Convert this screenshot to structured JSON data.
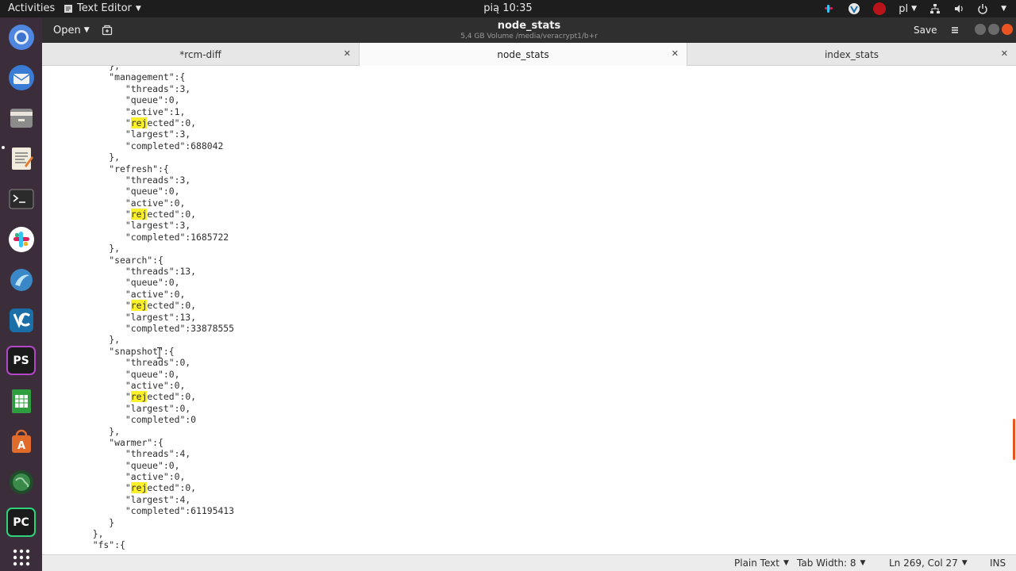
{
  "topbar": {
    "activities": "Activities",
    "app_name": "Text Editor",
    "clock": "pią 10:35",
    "keyboard_layout": "pl"
  },
  "window": {
    "title": "node_stats",
    "subtitle": "5,4 GB Volume /media/veracrypt1/b+r",
    "open_label": "Open",
    "save_label": "Save"
  },
  "tabs": [
    {
      "label": "*rcm-diff",
      "active": false
    },
    {
      "label": "node_stats",
      "active": true
    },
    {
      "label": "index_stats",
      "active": false
    }
  ],
  "search_highlight": "rej",
  "code_lines": [
    "            },",
    "            \"management\":{",
    "               \"threads\":3,",
    "               \"queue\":0,",
    "               \"active\":1,",
    "               \"rejected\":0,",
    "               \"largest\":3,",
    "               \"completed\":688042",
    "            },",
    "            \"refresh\":{",
    "               \"threads\":3,",
    "               \"queue\":0,",
    "               \"active\":0,",
    "               \"rejected\":0,",
    "               \"largest\":3,",
    "               \"completed\":1685722",
    "            },",
    "            \"search\":{",
    "               \"threads\":13,",
    "               \"queue\":0,",
    "               \"active\":0,",
    "               \"rejected\":0,",
    "               \"largest\":13,",
    "               \"completed\":33878555",
    "            },",
    "            \"snapshot\":{",
    "               \"threads\":0,",
    "               \"queue\":0,",
    "               \"active\":0,",
    "               \"rejected\":0,",
    "               \"largest\":0,",
    "               \"completed\":0",
    "            },",
    "            \"warmer\":{",
    "               \"threads\":4,",
    "               \"queue\":0,",
    "               \"active\":0,",
    "               \"rejected\":0,",
    "               \"largest\":4,",
    "               \"completed\":61195413",
    "            }",
    "         },",
    "         \"fs\":{"
  ],
  "statusbar": {
    "language": "Plain Text",
    "tab_width": "Tab Width: 8",
    "position": "Ln 269, Col 27",
    "mode": "INS"
  },
  "dock": [
    {
      "name": "chromium-icon",
      "color": "#3f7fd6"
    },
    {
      "name": "thunderbird-icon",
      "color": "#2f6fb8"
    },
    {
      "name": "files-icon",
      "color": "#8a8a8a"
    },
    {
      "name": "text-editor-icon",
      "color": "#e8e4d8"
    },
    {
      "name": "terminal-icon",
      "color": "#2b2b2b"
    },
    {
      "name": "slack-icon",
      "color": "#ffffff"
    },
    {
      "name": "app-icon-blue",
      "color": "#3a88c8"
    },
    {
      "name": "veracrypt-icon",
      "color": "#1a6fa8"
    },
    {
      "name": "phpstorm-icon",
      "color": "#1b1b1b"
    },
    {
      "name": "calc-icon",
      "color": "#2e9e3e"
    },
    {
      "name": "software-center-icon",
      "color": "#e06b2a"
    },
    {
      "name": "globe-icon",
      "color": "#2a6a3a"
    },
    {
      "name": "pycharm-icon",
      "color": "#1b1b1b"
    },
    {
      "name": "show-apps-icon",
      "color": "transparent"
    }
  ],
  "colors": {
    "highlight": "#fbf029",
    "dock_bg": "#3b2e3a",
    "headerbar_bg": "#2f2f2f",
    "scroll_indicator": "#e95420"
  }
}
